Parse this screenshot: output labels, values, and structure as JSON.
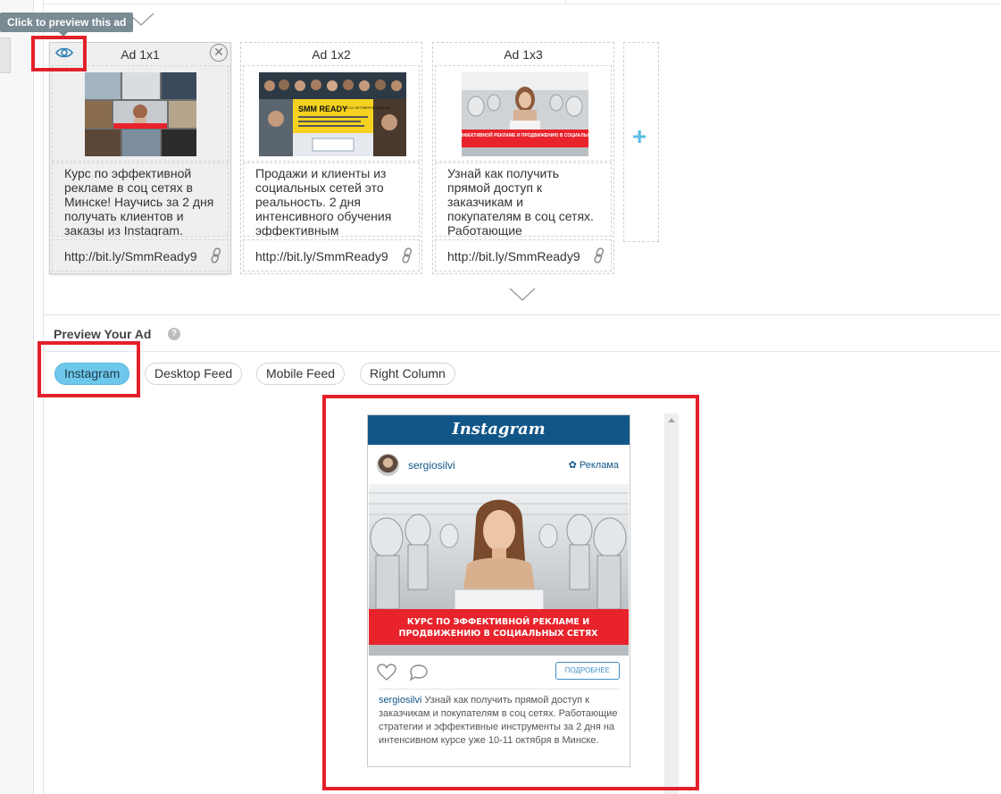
{
  "tooltip": {
    "text": "Click to preview this ad"
  },
  "cards": [
    {
      "title": "Ad 1x1",
      "text": "Курс по эффективной рекламе в соц сетях в Минске! Научись за 2 дня получать клиентов и заказы из Instagram.",
      "link": "http://bit.ly/SmmReady9"
    },
    {
      "title": "Ad 1x2",
      "text": "Продажи и клиенты из социальных сетей это реальность. 2 дня интенсивного обучения эффективным",
      "link": "http://bit.ly/SmmReady9",
      "banner": {
        "title": "SMM READY",
        "dates": "10-11 ОКТЯБРЯ В МИНСКЕ",
        "subtitle": "интенсивный курс по эффективной рекламе и продвижению в соц сетях в Минске"
      }
    },
    {
      "title": "Ad 1x3",
      "text": "Узнай как получить прямой доступ к заказчикам и покупателям в соц сетях. Работающие",
      "link": "http://bit.ly/SmmReady9",
      "banner_text": "КУРС ПО ЭФФЕКТИВНОЙ РЕКЛАМЕ И ПРОДВИЖЕНИЮ В СОЦИАЛЬНЫХ СЕТЯХ"
    }
  ],
  "add_card": {
    "label": "+"
  },
  "preview": {
    "title": "Preview Your Ad",
    "help": "?",
    "tabs": [
      {
        "label": "Instagram",
        "active": true
      },
      {
        "label": "Desktop Feed",
        "active": false
      },
      {
        "label": "Mobile Feed",
        "active": false
      },
      {
        "label": "Right Column",
        "active": false
      }
    ]
  },
  "instagram": {
    "logo": "Instagram",
    "username": "sergiosilvi",
    "sponsored": "✿ Реклама",
    "image_banner_line1": "КУРС ПО ЭФФЕКТИВНОЙ РЕКЛАМЕ И",
    "image_banner_line2": "ПРОДВИЖЕНИЮ В СОЦИАЛЬНЫХ СЕТЯХ",
    "more_button": "ПОДРОБНЕЕ",
    "caption_user": "sergiosilvi",
    "caption_text": " Узнай как получить прямой доступ к заказчикам и покупателям в соц сетях. Работающие стратегии и эффективные инструменты за 2 дня на интенсивном курсе уже 10-11 октября в Минске."
  },
  "colors": {
    "accent_blue": "#6ec8eb",
    "instagram_blue": "#125688",
    "highlight_red": "#e2202a",
    "banner_red": "#e8232b"
  }
}
